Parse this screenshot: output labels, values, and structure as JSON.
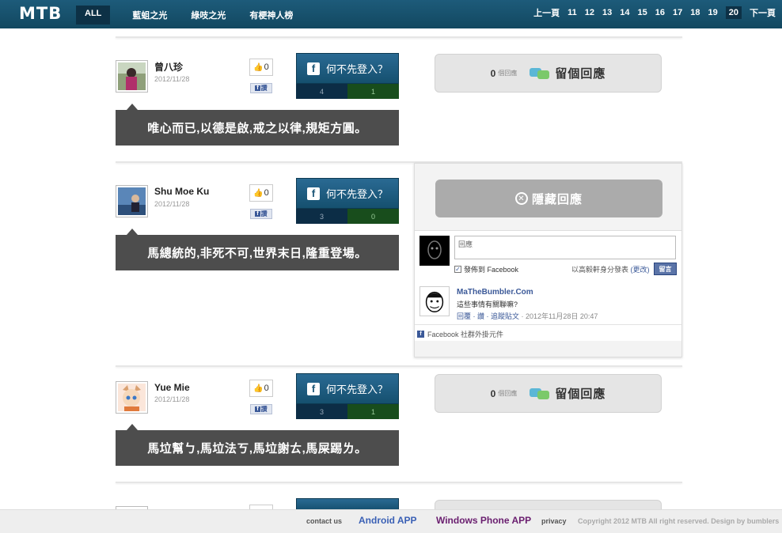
{
  "header": {
    "logo": "MTB",
    "nav": [
      "ALL",
      "藍蛆之光",
      "綠吱之光",
      "有梗神人榜"
    ],
    "pager": {
      "prev": "上一頁",
      "pages": [
        "11",
        "12",
        "13",
        "14",
        "15",
        "16",
        "17",
        "18",
        "19",
        "20"
      ],
      "current": "20",
      "next": "下一頁"
    }
  },
  "posts": [
    {
      "name": "曾八珍",
      "date": "2012/11/28",
      "likes": "0",
      "share_label": "讚",
      "login_label": "何不先登入？",
      "vote_left": "4",
      "vote_right": "1",
      "reply_count": "0",
      "reply_count_label": "個回應",
      "reply_label": "留個回應",
      "quote": "唯心而已,以德是啟,戒之以律,規矩方圓。"
    },
    {
      "name": "Shu Moe Ku",
      "date": "2012/11/28",
      "likes": "0",
      "share_label": "讚",
      "login_label": "何不先登入？",
      "vote_left": "3",
      "vote_right": "0",
      "hide_label": "隱藏回應",
      "quote": "馬總統的,非死不可,世界末日,隆重登場。"
    },
    {
      "name": "Yue Mie",
      "date": "2012/11/28",
      "likes": "0",
      "share_label": "讚",
      "login_label": "何不先登入？",
      "vote_left": "3",
      "vote_right": "1",
      "reply_count": "0",
      "reply_count_label": "個回應",
      "reply_label": "留個回應",
      "quote": "馬垃幫ㄅ,馬垃法ㄎ,馬垃謝ㄊ,馬屎踢ㄌ。"
    }
  ],
  "fb_comments": {
    "placeholder": "回應",
    "post_to_fb": "發佈到 Facebook",
    "as_user": "以高毅軒身分發表",
    "change": "(更改)",
    "submit": "留言",
    "comment": {
      "author": "MaTheBumbler.Com",
      "text": "這些事情有關聯嘛?",
      "actions": "回覆 · 讚 · 追蹤貼文",
      "time": " · 2012年11月28日 20:47"
    },
    "plugin": "Facebook 社群外掛元件"
  },
  "footer": {
    "contact": "contact us",
    "android": "Android APP",
    "winphone": "Windows Phone APP",
    "privacy": "privacy",
    "copyright": "Copyright 2012 MTB All right reserved.  Design by bumblers"
  },
  "colors": {
    "topbar": "#1d5b7a",
    "login_button": "#1c5677",
    "vote_left": "#0c2d46",
    "vote_right": "#184d1c",
    "quote_bg": "#4d4d4d"
  }
}
